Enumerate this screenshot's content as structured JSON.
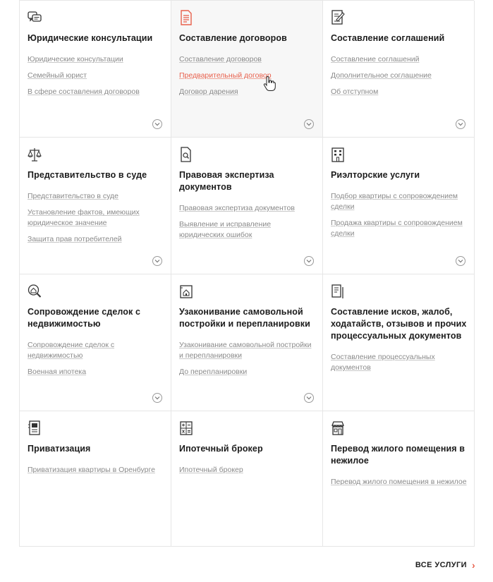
{
  "services": [
    {
      "icon": "chat-bubbles-icon",
      "title": "Юридические консультации",
      "links": [
        "Юридические консультации",
        "Семейный юрист",
        "В сфере составления договоров"
      ],
      "expandable": true
    },
    {
      "icon": "document-red-icon",
      "title": "Составление договоров",
      "links": [
        "Составление договоров",
        "Предварительный договор",
        "Договор дарения"
      ],
      "expandable": true
    },
    {
      "icon": "document-pen-icon",
      "title": "Составление соглашений",
      "links": [
        "Составление соглашений",
        "Дополнительное соглашение",
        "Об отступном"
      ],
      "expandable": true
    },
    {
      "icon": "scales-icon",
      "title": "Представительство в суде",
      "links": [
        "Представительство в суде",
        "Установление фактов, имеющих юридическое значение",
        "Защита прав потребителей"
      ],
      "expandable": true
    },
    {
      "icon": "document-search-icon",
      "title": "Правовая экспертиза документов",
      "links": [
        "Правовая экспертиза документов",
        "Выявление и исправление юридических ошибок"
      ],
      "expandable": true
    },
    {
      "icon": "building-icon",
      "title": "Риэлторские услуги",
      "links": [
        "Подбор квартиры с сопровождением сделки",
        "Продажа квартиры с сопровождением сделки"
      ],
      "expandable": true
    },
    {
      "icon": "house-magnifier-icon",
      "title": "Сопровождение сделок с недвижимостью",
      "links": [
        "Сопровождение сделок с недвижимостью",
        "Военная ипотека"
      ],
      "expandable": true
    },
    {
      "icon": "house-plan-icon",
      "title": "Узаконивание самовольной постройки и перепланировки",
      "links": [
        "Узаконивание самовольной постройки и перепланировки",
        "До перепланировки"
      ],
      "expandable": true
    },
    {
      "icon": "documents-stack-icon",
      "title": "Составление исков, жалоб, ходатайств, отзывов и прочих процессуальных документов",
      "links": [
        "Составление процессуальных документов"
      ],
      "expandable": false
    },
    {
      "icon": "certificate-icon",
      "title": "Приватизация",
      "links": [
        "Приватизация квартиры в Оренбурге"
      ],
      "expandable": false
    },
    {
      "icon": "calculator-icon",
      "title": "Ипотечный брокер",
      "links": [
        "Ипотечный брокер"
      ],
      "expandable": false
    },
    {
      "icon": "shop-icon",
      "title": "Перевод жилого помещения в нежилое",
      "links": [
        "Перевод жилого помещения в нежилое"
      ],
      "expandable": false
    }
  ],
  "hovered_card": 1,
  "hovered_link": "Предварительный договор",
  "footer": {
    "all_services_label": "ВСЕ УСЛУГИ",
    "arrow": "›"
  },
  "colors": {
    "accent": "#e8604c",
    "link": "#8a8a8a",
    "border": "#e6e6e6"
  }
}
